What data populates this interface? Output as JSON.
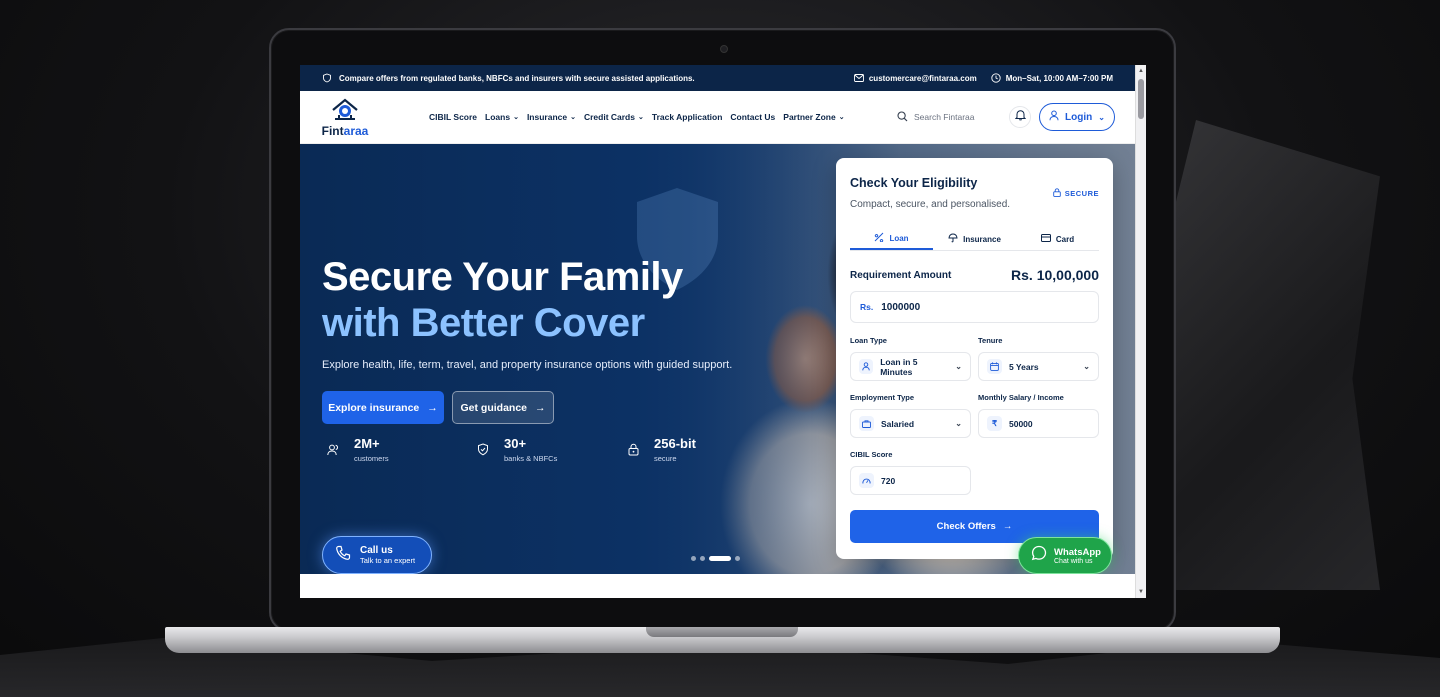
{
  "topbar": {
    "message": "Compare offers from regulated banks, NBFCs and insurers with secure assisted applications.",
    "email": "customercare@fintaraa.com",
    "hours": "Mon–Sat, 10:00 AM–7:00 PM"
  },
  "brand": {
    "name_part1": "Fint",
    "name_part2": "araa"
  },
  "nav": {
    "items": [
      {
        "label": "CIBIL Score",
        "dropdown": false
      },
      {
        "label": "Loans",
        "dropdown": true
      },
      {
        "label": "Insurance",
        "dropdown": true
      },
      {
        "label": "Credit Cards",
        "dropdown": true
      },
      {
        "label": "Track Application",
        "dropdown": false
      },
      {
        "label": "Contact Us",
        "dropdown": false
      },
      {
        "label": "Partner Zone",
        "dropdown": true
      }
    ],
    "search_placeholder": "Search Fintaraa",
    "login_label": "Login"
  },
  "hero": {
    "title_line1": "Secure Your Family",
    "title_line2": "with Better Cover",
    "subtitle": "Explore health, life, term, travel, and property insurance options with guided support.",
    "primary_cta": "Explore insurance",
    "secondary_cta": "Get guidance",
    "stats": [
      {
        "value": "2M+",
        "label": "customers",
        "icon": "users-icon"
      },
      {
        "value": "30+",
        "label": "banks & NBFCs",
        "icon": "shield-check-icon"
      },
      {
        "value": "256-bit",
        "label": "secure",
        "icon": "lock-icon"
      }
    ],
    "call": {
      "title": "Call us",
      "subtitle": "Talk to an expert"
    },
    "carousel": {
      "count": 4,
      "active_index": 2
    }
  },
  "eligibility": {
    "title": "Check Your Eligibility",
    "subtitle": "Compact, secure, and personalised.",
    "badge": "SECURE",
    "tabs": [
      {
        "label": "Loan",
        "active": true
      },
      {
        "label": "Insurance",
        "active": false
      },
      {
        "label": "Card",
        "active": false
      }
    ],
    "requirement_label": "Requirement Amount",
    "requirement_display": "Rs. 10,00,000",
    "amount_prefix": "Rs.",
    "amount_value": "1000000",
    "loan_type_label": "Loan Type",
    "loan_type_value": "Loan in 5 Minutes",
    "tenure_label": "Tenure",
    "tenure_value": "5 Years",
    "employment_label": "Employment Type",
    "employment_value": "Salaried",
    "salary_label": "Monthly Salary / Income",
    "salary_value": "50000",
    "cibil_label": "CIBIL Score",
    "cibil_value": "720",
    "submit_label": "Check Offers"
  },
  "whatsapp": {
    "title": "WhatsApp",
    "subtitle": "Chat with us"
  },
  "colors": {
    "navy": "#0c2548",
    "primary": "#1f63e8",
    "accent_light": "#8cc2ff",
    "whatsapp": "#1fa44a"
  }
}
